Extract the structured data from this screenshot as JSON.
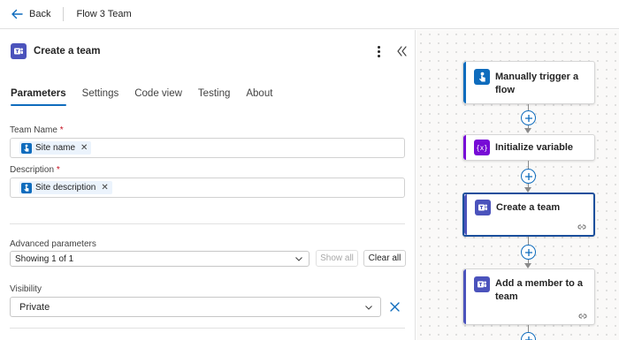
{
  "header": {
    "back_label": "Back",
    "flow_name": "Flow 3 Team"
  },
  "panel": {
    "title": "Create a team",
    "tabs": [
      {
        "label": "Parameters",
        "active": true
      },
      {
        "label": "Settings",
        "active": false
      },
      {
        "label": "Code view",
        "active": false
      },
      {
        "label": "Testing",
        "active": false
      },
      {
        "label": "About",
        "active": false
      }
    ],
    "team_name": {
      "label": "Team Name",
      "required_mark": "*",
      "token": "Site name"
    },
    "description": {
      "label": "Description",
      "required_mark": "*",
      "token": "Site description"
    },
    "advanced": {
      "label": "Advanced parameters",
      "selected": "Showing 1 of 1",
      "show_all_label": "Show all",
      "clear_all_label": "Clear all"
    },
    "visibility": {
      "label": "Visibility",
      "value": "Private"
    }
  },
  "canvas": {
    "nodes": [
      {
        "title": "Manually trigger a flow",
        "icon": "touch-trigger-icon",
        "color": "#0f6cbd"
      },
      {
        "title": "Initialize variable",
        "icon": "variable-icon",
        "color": "#770bd6"
      },
      {
        "title": "Create a team",
        "icon": "teams-icon",
        "color": "#4b53bc"
      },
      {
        "title": "Add a member to a team",
        "icon": "teams-icon",
        "color": "#4b53bc"
      }
    ]
  },
  "colors": {
    "accent": "#0f6cbd",
    "teams": "#4b53bc",
    "variable": "#770bd6",
    "selected_border": "#1b4f9c"
  }
}
